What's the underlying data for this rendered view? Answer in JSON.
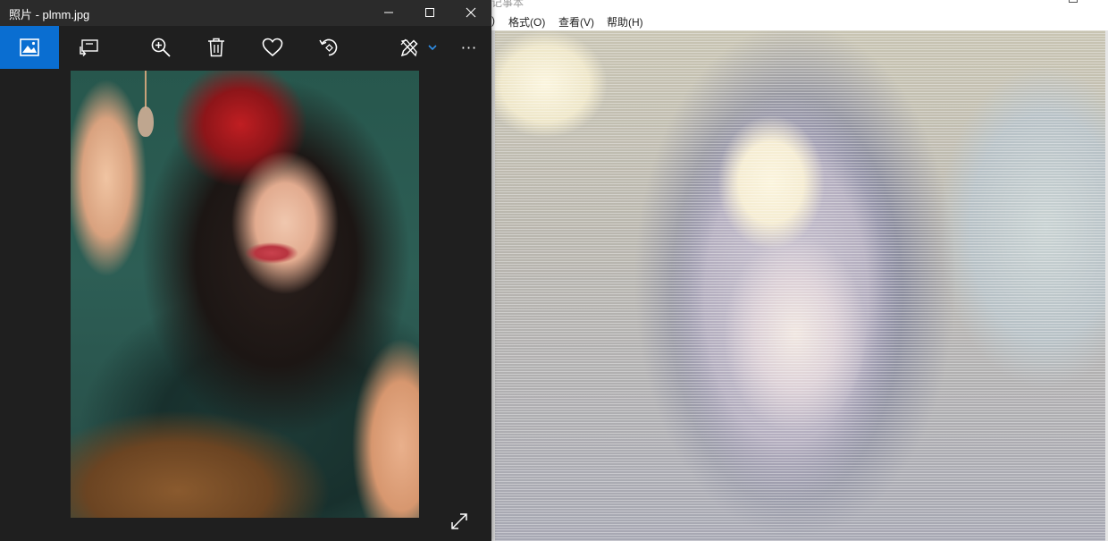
{
  "photos_window": {
    "title": "照片 - plmm.jpg",
    "toolbar": [
      {
        "icon": "image-collection-icon"
      },
      {
        "icon": "slideshow-icon"
      },
      {
        "icon": "zoom-in-icon"
      },
      {
        "icon": "delete-icon"
      },
      {
        "icon": "heart-icon"
      },
      {
        "icon": "rotate-icon"
      },
      {
        "icon": "edit-draw-icon"
      },
      {
        "icon": "more-icon"
      }
    ],
    "more_glyph": "···",
    "accent": "#0a6ed1"
  },
  "notepad_window": {
    "title_fragment": "记事本",
    "menu": {
      "edit_fragment": ")",
      "format": "格式(O)",
      "view": "查看(V)",
      "help": "帮助(H)"
    }
  }
}
